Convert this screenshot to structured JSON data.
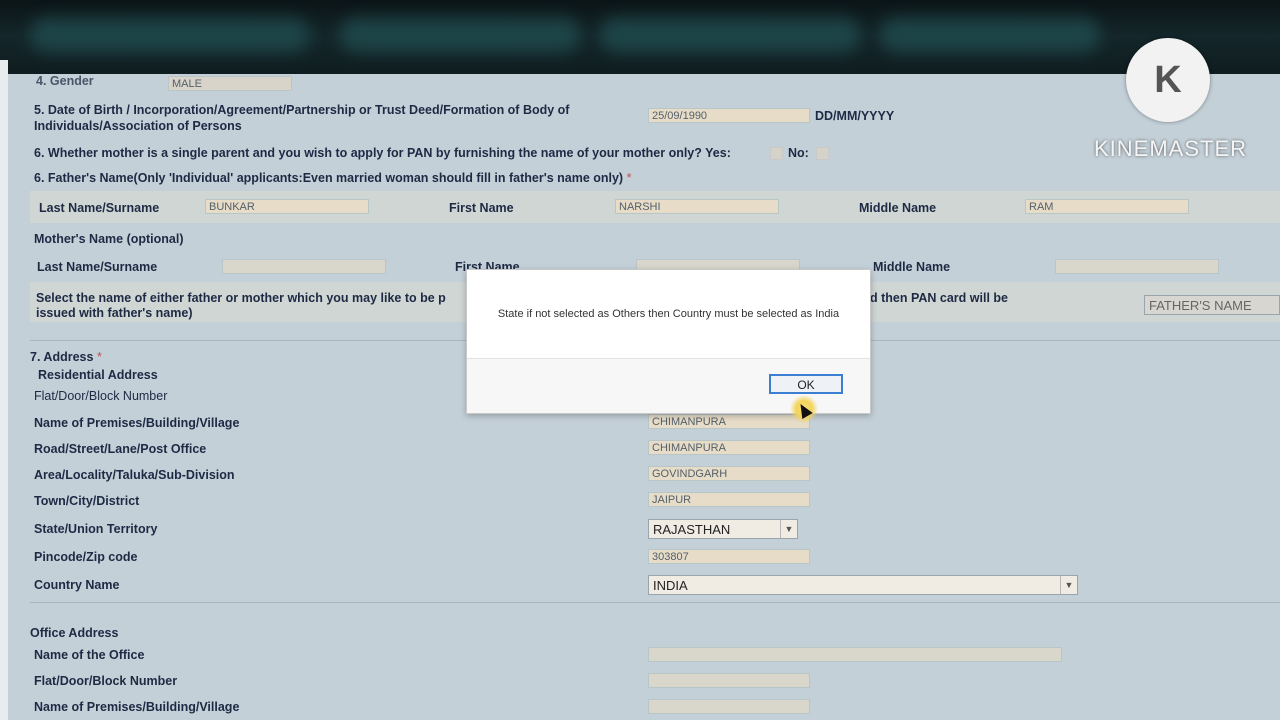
{
  "form": {
    "gender_label": "4. Gender",
    "gender_value": "MALE",
    "dob_label_line1": "5. Date of Birth / Incorporation/Agreement/Partnership or Trust Deed/Formation of Body of",
    "dob_label_line2": "Individuals/Association of Persons",
    "dob_value": "25/09/1990",
    "dob_format": "DD/MM/YYYY",
    "single_parent_label": "6. Whether mother is a single parent and you wish to apply for PAN by furnishing the name of your mother only? Yes:",
    "single_parent_no": "No:",
    "father_heading": "6. Father's Name(Only 'Individual' applicants:Even married woman should fill in father's name only)",
    "required_star": "*",
    "father": {
      "last_label": "Last Name/Surname",
      "last_value": "BUNKAR",
      "first_label": "First Name",
      "first_value": "NARSHI",
      "middle_label": "Middle Name",
      "middle_value": "RAM"
    },
    "mother_heading": "Mother's Name (optional)",
    "mother": {
      "last_label": "Last Name/Surname",
      "first_label": "First Name",
      "middle_label": "Middle Name"
    },
    "select_name_line1_left": "Select the name of either father or mother which you may like to be p",
    "select_name_line1_right": "d then PAN card will be",
    "select_name_line2": "issued with father's name)",
    "select_name_value": "FATHER'S NAME",
    "address_heading": "7. Address",
    "residential_heading": "Residential Address",
    "residential": {
      "flat_label": "Flat/Door/Block Number",
      "premises_label": "Name of Premises/Building/Village",
      "premises_value": "CHIMANPURA",
      "road_label": "Road/Street/Lane/Post Office",
      "road_value": "CHIMANPURA",
      "area_label": "Area/Locality/Taluka/Sub-Division",
      "area_value": "GOVINDGARH",
      "town_label": "Town/City/District",
      "town_value": "JAIPUR",
      "state_label": "State/Union Territory",
      "state_value": "RAJASTHAN",
      "pincode_label": "Pincode/Zip code",
      "pincode_value": "303807",
      "country_label": "Country Name",
      "country_value": "INDIA"
    },
    "office_heading": "Office Address",
    "office": {
      "name_label": "Name of the Office",
      "flat_label": "Flat/Door/Block Number",
      "premises_label": "Name of Premises/Building/Village"
    }
  },
  "dialog": {
    "message": "State if not selected as Others then Country must be selected as India",
    "ok_label": "OK"
  },
  "watermark": {
    "logo_letter": "K",
    "text": "KINEMASTER"
  },
  "colors": {
    "background": "#c4d0d8",
    "input_fill": "#e6dcc8",
    "label_text": "#1e2a44",
    "dialog_button_border": "#3c7fd0"
  }
}
